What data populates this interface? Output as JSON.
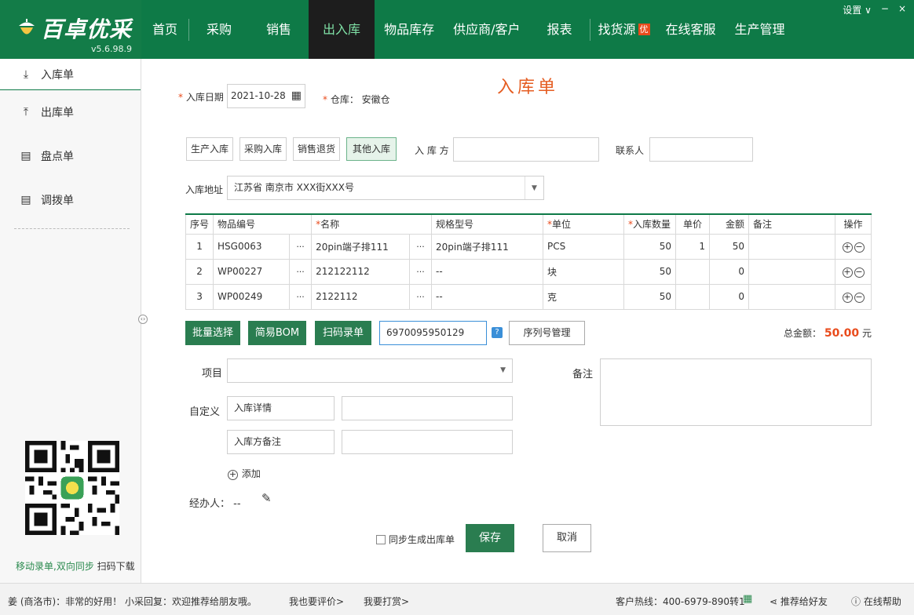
{
  "app": {
    "name": "百卓优采",
    "version": "v5.6.98.9",
    "window_controls": {
      "settings": "设置 ∨",
      "minimize": "−",
      "close": "×"
    }
  },
  "nav": {
    "items": [
      {
        "label": "首页"
      },
      {
        "label": "采购"
      },
      {
        "label": "销售"
      },
      {
        "label": "出入库"
      },
      {
        "label": "物品库存"
      },
      {
        "label": "供应商/客户"
      },
      {
        "label": "报表"
      },
      {
        "label": "找货源",
        "badge": "优"
      },
      {
        "label": "在线客服"
      },
      {
        "label": "生产管理"
      }
    ],
    "active": "出入库"
  },
  "sidebar": {
    "items": [
      {
        "label": "入库单",
        "icon": "inbox-in-icon"
      },
      {
        "label": "出库单",
        "icon": "inbox-out-icon"
      },
      {
        "label": "盘点单",
        "icon": "doc-list-icon"
      },
      {
        "label": "调拨单",
        "icon": "doc-list-icon"
      }
    ],
    "qr_caption_green": "移动录单,双向同步",
    "qr_caption": "扫码下载"
  },
  "form": {
    "title": "入库单",
    "date_label": "入库日期",
    "date_value": "2021-10-28",
    "warehouse_label": "仓库：",
    "warehouse_value": "安徽仓",
    "types": [
      "生产入库",
      "采购入库",
      "销售退货",
      "其他入库"
    ],
    "active_type": "其他入库",
    "party_label": "入 库 方",
    "party_value": "",
    "contact_label": "联系人",
    "contact_value": "",
    "address_label": "入库地址",
    "address_value": "江苏省 南京市 XXX街XXX号"
  },
  "table": {
    "headers": [
      "序号",
      "物品编号",
      "名称",
      "规格型号",
      "单位",
      "入库数量",
      "单价",
      "金额",
      "备注",
      "操作"
    ],
    "rows": [
      {
        "no": "1",
        "code": "HSG0063",
        "name": "20pin端子排111",
        "spec": "20pin端子排111",
        "unit": "PCS",
        "qty": "50",
        "price": "1",
        "amount": "50",
        "note": ""
      },
      {
        "no": "2",
        "code": "WP00227",
        "name": "212122112",
        "spec": "--",
        "unit": "块",
        "qty": "50",
        "price": "",
        "amount": "0",
        "note": ""
      },
      {
        "no": "3",
        "code": "WP00249",
        "name": "2122112",
        "spec": "--",
        "unit": "克",
        "qty": "50",
        "price": "",
        "amount": "0",
        "note": ""
      }
    ]
  },
  "actions": {
    "batch_select": "批量选择",
    "simple_bom": "简易BOM",
    "scan_entry": "扫码录单",
    "barcode_value": "6970095950129",
    "serial_mgmt": "序列号管理",
    "total_label": "总金额：",
    "total_value": "50.00",
    "total_unit": "元"
  },
  "extra": {
    "project_label": "项目",
    "project_value": "",
    "remark_label": "备注",
    "custom_label": "自定义",
    "custom_fields": [
      {
        "name": "入库详情",
        "value": ""
      },
      {
        "name": "入库方备注",
        "value": ""
      }
    ],
    "add_label": "添加",
    "handler_label": "经办人：",
    "handler_value": "--"
  },
  "footer": {
    "sync_label": "同步生成出库单",
    "save": "保存",
    "cancel": "取消"
  },
  "status": {
    "message": "姜 (商洛市)：非常的好用！ 小采回复：欢迎推荐给朋友哦。",
    "rate": "我也要评价>",
    "tip": "我要打赏>",
    "hotline": "客户热线：400-6979-890转1",
    "recommend": "推荐给好友",
    "help": "在线帮助"
  },
  "colors": {
    "brand_green": "#0e7a47",
    "button_green": "#2a7d50",
    "accent_orange": "#e55d22",
    "nav_active_bg": "#1d1d1d"
  }
}
